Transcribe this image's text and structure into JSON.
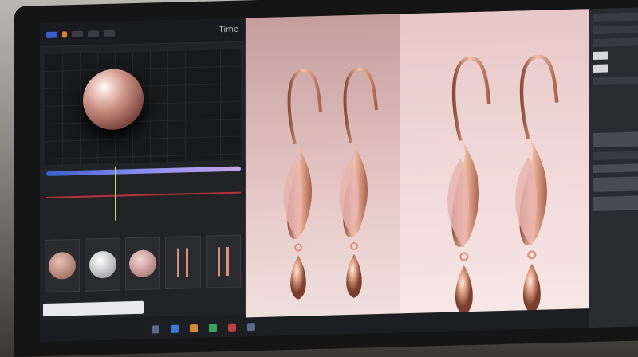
{
  "timeline": {
    "label": "Time"
  },
  "colors": {
    "accent": "#3b5cc9",
    "rose_gold": "#d9927a",
    "background_pink": "#efd6d5",
    "playhead": "#c9d46a"
  },
  "icons": [
    "sphere-preview",
    "material-thumbnail",
    "earring-thumbnail",
    "taskbar-app-icon"
  ]
}
